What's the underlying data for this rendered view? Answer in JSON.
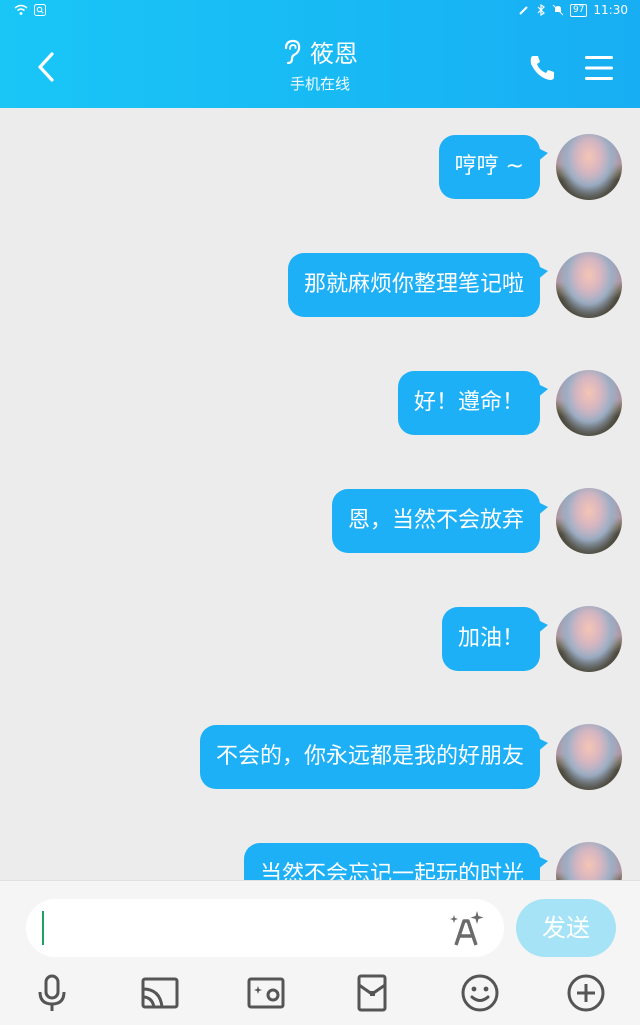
{
  "status_bar": {
    "battery": "97",
    "time": "11:30"
  },
  "header": {
    "title": "筱恩",
    "subtitle": "手机在线"
  },
  "messages": [
    {
      "text": "哼哼 ~"
    },
    {
      "text": "那就麻烦你整理笔记啦"
    },
    {
      "text": "好！遵命！"
    },
    {
      "text": "恩，当然不会放弃"
    },
    {
      "text": "加油！"
    },
    {
      "text": "不会的，你永远都是我的好朋友"
    },
    {
      "text": "当然不会忘记一起玩的时光"
    }
  ],
  "input": {
    "value": "",
    "send_label": "发送"
  },
  "toolbar": {
    "icons": [
      "microphone-icon",
      "cast-icon",
      "photo-icon",
      "red-packet-icon",
      "emoji-icon",
      "plus-icon"
    ]
  },
  "colors": {
    "accent": "#1eb0f6",
    "header_start": "#19c6f6",
    "header_end": "#18aef3",
    "send_disabled": "#a6e3f7"
  }
}
